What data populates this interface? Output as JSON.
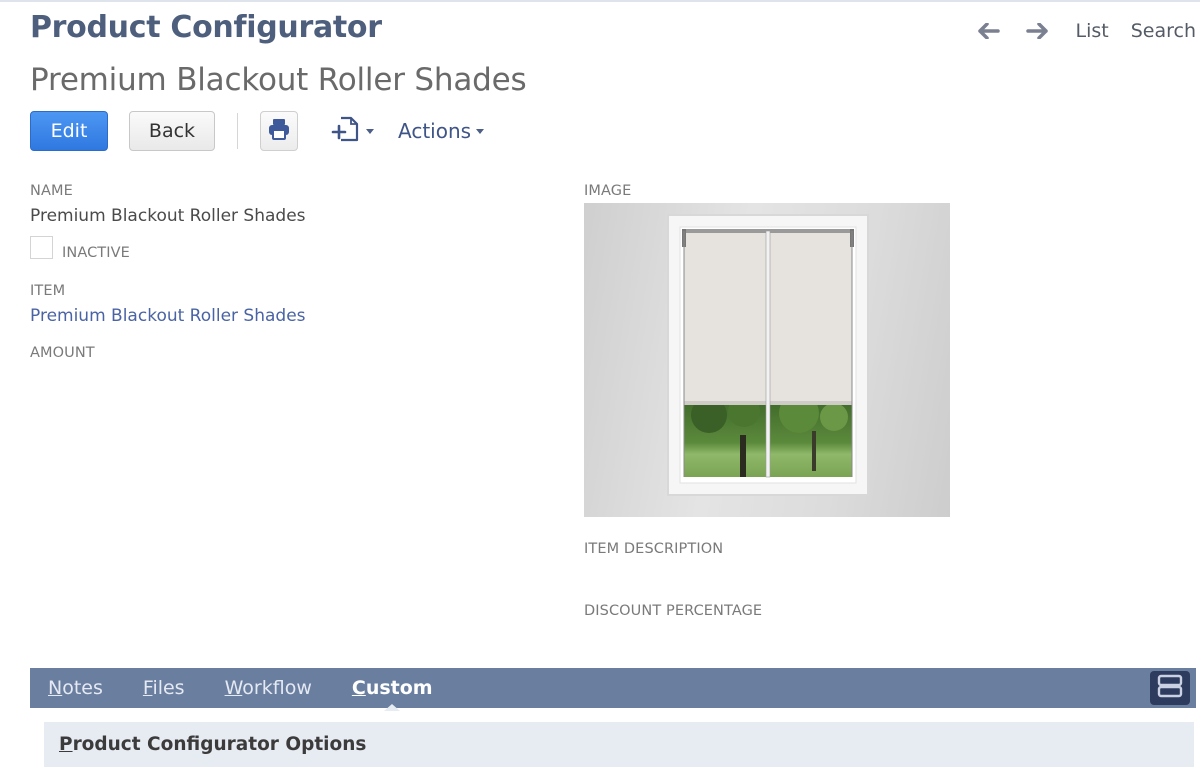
{
  "header": {
    "page_title": "Product Configurator",
    "record_title": "Premium Blackout Roller Shades",
    "nav": {
      "back_icon": "arrow-left-icon",
      "forward_icon": "arrow-right-icon",
      "list_label": "List",
      "search_label": "Search"
    }
  },
  "toolbar": {
    "edit_label": "Edit",
    "back_label": "Back",
    "print_icon": "printer-icon",
    "new_icon": "new-document-plus-icon",
    "actions_label": "Actions"
  },
  "fields": {
    "name_label": "NAME",
    "name_value": "Premium Blackout Roller Shades",
    "inactive_label": "INACTIVE",
    "inactive_checked": false,
    "item_label": "ITEM",
    "item_value": "Premium Blackout Roller Shades",
    "amount_label": "AMOUNT",
    "amount_value": "",
    "image_label": "IMAGE",
    "image_alt": "Window with two white roller shades partially lowered, trees visible outside",
    "item_description_label": "ITEM DESCRIPTION",
    "item_description_value": "",
    "discount_percentage_label": "DISCOUNT PERCENTAGE",
    "discount_percentage_value": ""
  },
  "subtabs": {
    "items": [
      {
        "accel": "N",
        "rest": "otes",
        "active": false
      },
      {
        "accel": "F",
        "rest": "iles",
        "active": false
      },
      {
        "accel": "W",
        "rest": "orkflow",
        "active": false
      },
      {
        "accel": "C",
        "rest": "ustom",
        "active": true
      }
    ],
    "layout_icon": "layout-toggle-icon"
  },
  "section": {
    "title_accel": "P",
    "title_rest": "roduct Configurator Options"
  },
  "colors": {
    "primary_button": "#3a86ea",
    "link": "#4a63a5",
    "subtab_bar": "#6a7ea0",
    "section_header": "#e7ebf2",
    "title": "#4d5f7c"
  }
}
